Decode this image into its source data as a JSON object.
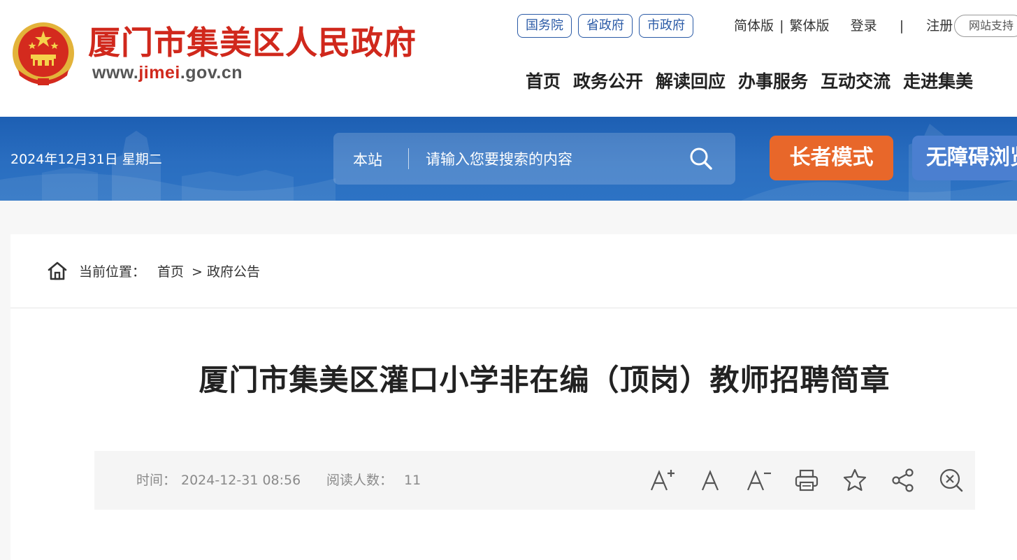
{
  "header": {
    "site_name": "厦门市集美区人民政府",
    "site_url_prefix": "www.",
    "site_url_highlight": "jimei",
    "site_url_suffix": ".gov.cn",
    "gov_links": [
      "国务院",
      "省政府",
      "市政府"
    ],
    "simplified": "简体版",
    "divider": "|",
    "traditional": "繁体版",
    "login": "登录",
    "register": "注册",
    "site_support": "网站支持",
    "nav": [
      "首页",
      "政务公开",
      "解读回应",
      "办事服务",
      "互动交流",
      "走进集美"
    ]
  },
  "banner": {
    "date": "2024年12月31日 星期二",
    "search_scope": "本站",
    "search_placeholder": "请输入您要搜索的内容",
    "elder_mode": "长者模式",
    "accessibility": "无障碍浏览"
  },
  "breadcrumb": {
    "label": "当前位置：",
    "home": "首页",
    "separator": ">",
    "current": "政府公告"
  },
  "article": {
    "title": "厦门市集美区灌口小学非在编（顶岗）教师招聘简章",
    "time_label": "时间：",
    "time_value": "2024-12-31 08:56",
    "reads_label": "阅读人数：",
    "reads_value": "11"
  },
  "tools": [
    "font-increase-icon",
    "font-normal-icon",
    "font-decrease-icon",
    "print-icon",
    "favorite-star-icon",
    "share-icon",
    "close-zoom-icon"
  ],
  "colors": {
    "brand_red": "#d0281c",
    "link_blue": "#2a5aa6",
    "banner_blue": "#2566b8",
    "elder_orange": "#e8672a",
    "access_blue": "#4b7fd0"
  }
}
